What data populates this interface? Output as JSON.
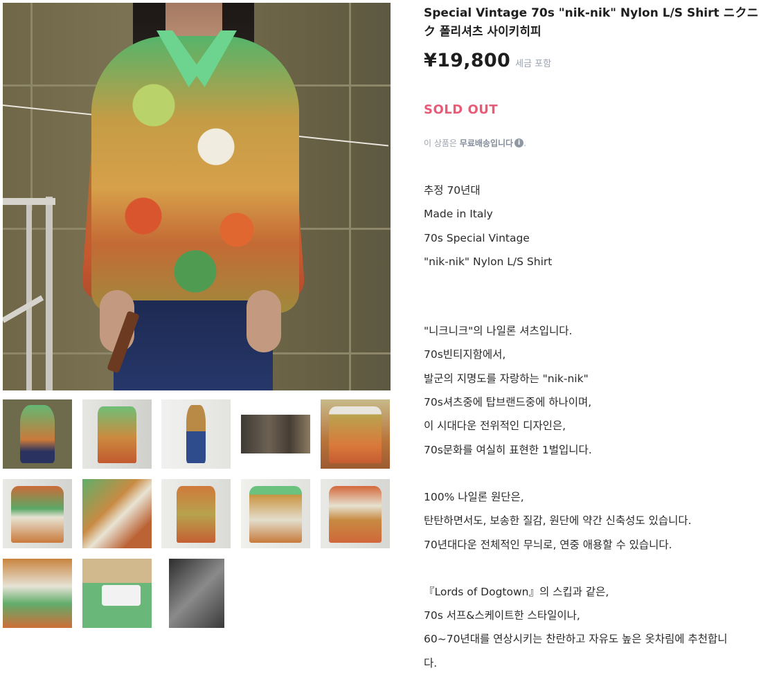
{
  "product": {
    "title": "Special Vintage 70s \"nik-nik\" Nylon L/S Shirt ニクニク 폴리셔츠 사이키히피",
    "price": "¥19,800",
    "tax_note": "세금 포함",
    "status": "SOLD OUT",
    "shipping_prefix": "이 상품은 ",
    "shipping_bold": "무료배송",
    "shipping_suffix": "입니다",
    "shipping_end": "."
  },
  "gallery": {
    "thumbnail_count": 13
  },
  "description": {
    "spec_lines": [
      "추정 70년대",
      "Made in Italy",
      "70s Special Vintage",
      "\"nik-nik\" Nylon L/S Shirt"
    ],
    "para1": [
      "\"니크니크\"의 나일론 셔츠입니다.",
      "70s빈티지함에서,",
      "발군의 지명도를 자랑하는 \"nik-nik\"",
      "70s셔츠중에 탑브랜드중에 하나이며,",
      "이 시대다운 전위적인 디자인은,",
      "70s문화를 여실히 표현한 1벌입니다."
    ],
    "para2": [
      "100% 나일론 원단은,",
      "탄탄하면서도, 보송한 질감, 원단에 약간 신축성도 있습니다.",
      "70년대다운 전체적인 무늬로, 연중 애용할 수 있습니다."
    ],
    "para3": [
      "『Lords of Dogtown』의 스킵과 같은,",
      "70s 서프&스케이트한 스타일이나,",
      "60~70년대를 연상시키는 찬란하고 자유도 높은 옷차림에 추천합니",
      "다."
    ]
  },
  "colors": {
    "sold_out": "#e85a76",
    "muted_text": "#9aa3b0"
  },
  "icons": {
    "info": "info-circle-icon"
  }
}
